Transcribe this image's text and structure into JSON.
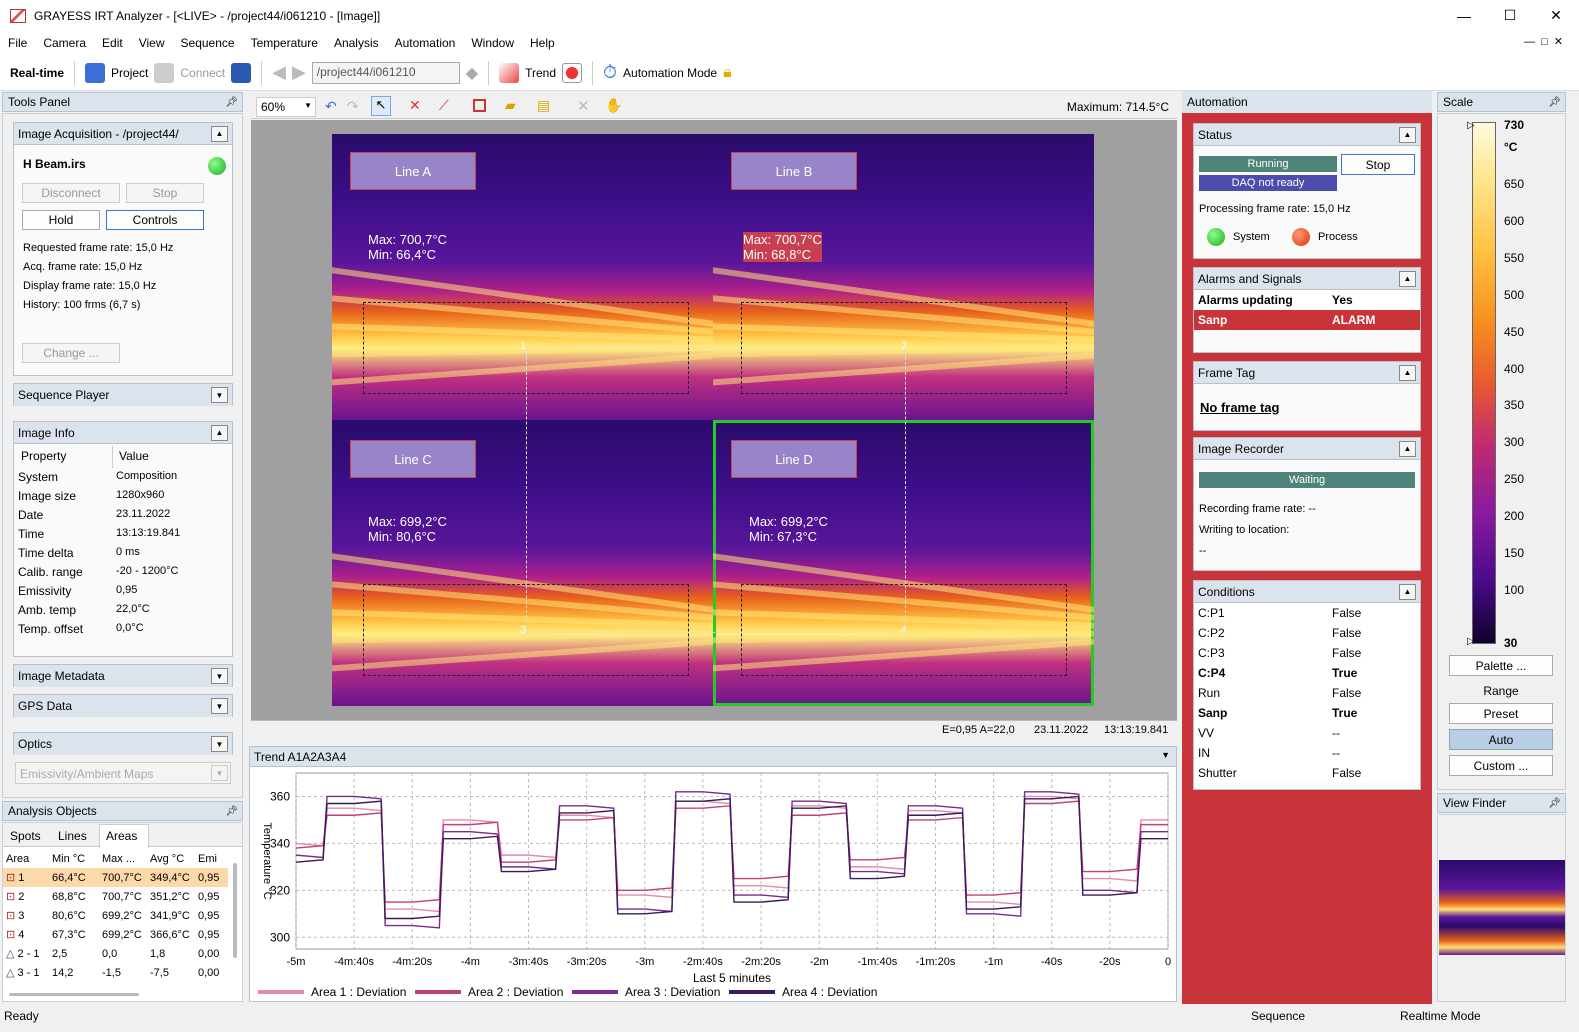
{
  "window": {
    "title": "GRAYESS IRT Analyzer - [<LIVE> - /project44/i061210 - [Image]]",
    "minimize": "—",
    "maximize": "☐",
    "close": "✕"
  },
  "menu": [
    "File",
    "Camera",
    "Edit",
    "View",
    "Sequence",
    "Temperature",
    "Analysis",
    "Automation",
    "Window",
    "Help"
  ],
  "toolbar": {
    "realtime": "Real-time",
    "project": "Project",
    "connect": "Connect",
    "path": "/project44/i061210",
    "trend": "Trend",
    "automation_mode": "Automation Mode"
  },
  "tools_panel": {
    "title": "Tools Panel",
    "acq": {
      "header": "Image Acquisition - /project44/",
      "file": "H Beam.irs",
      "disconnect": "Disconnect",
      "stop": "Stop",
      "hold": "Hold",
      "controls": "Controls",
      "lines": [
        "Requested frame rate: 15,0 Hz",
        "Acq. frame rate: 15,0 Hz",
        "Display frame rate: 15,0 Hz",
        "History: 100 frms (6,7 s)"
      ],
      "change": "Change ..."
    },
    "sequence_player": "Sequence Player",
    "image_info": {
      "header": "Image Info",
      "col_property": "Property",
      "col_value": "Value",
      "rows": [
        {
          "k": "System",
          "v": "Composition"
        },
        {
          "k": "Image size",
          "v": "1280x960"
        },
        {
          "k": "Date",
          "v": "23.11.2022"
        },
        {
          "k": "Time",
          "v": "13:13:19.841"
        },
        {
          "k": "Time delta",
          "v": "0 ms"
        },
        {
          "k": "Calib. range",
          "v": "-20 - 1200°C"
        },
        {
          "k": "Emissivity",
          "v": "0,95"
        },
        {
          "k": "Amb. temp",
          "v": "22,0°C"
        },
        {
          "k": "Temp. offset",
          "v": "0,0°C"
        }
      ]
    },
    "image_metadata": "Image Metadata",
    "gps": "GPS Data",
    "optics": "Optics",
    "emissivity_maps": "Emissivity/Ambient Maps"
  },
  "analysis": {
    "title": "Analysis Objects",
    "tabs": [
      "Spots",
      "Lines",
      "Areas"
    ],
    "columns": [
      "Area",
      "Min °C",
      "Max ...",
      "Avg °C",
      "Emi"
    ],
    "rows": [
      [
        "1",
        "66,4°C",
        "700,7°C",
        "349,4°C",
        "0,95"
      ],
      [
        "2",
        "68,8°C",
        "700,7°C",
        "351,2°C",
        "0,95"
      ],
      [
        "3",
        "80,6°C",
        "699,2°C",
        "341,9°C",
        "0,95"
      ],
      [
        "4",
        "67,3°C",
        "699,2°C",
        "366,6°C",
        "0,95"
      ],
      [
        "2 - 1",
        "2,5",
        "0,0",
        "1,8",
        "0,00"
      ],
      [
        "3 - 1",
        "14,2",
        "-1,5",
        "-7,5",
        "0,00"
      ]
    ]
  },
  "image_view": {
    "zoom": "60%",
    "maximum": "Maximum: 714.5°C",
    "quadrants": [
      {
        "label": "Line A",
        "max": "Max: 700,7°C",
        "min": "Min: 66,4°C",
        "num": "1"
      },
      {
        "label": "Line B",
        "max": "Max: 700,7°C",
        "min": "Min: 68,8°C",
        "num": "2"
      },
      {
        "label": "Line C",
        "max": "Max: 699,2°C",
        "min": "Min: 80,6°C",
        "num": "3"
      },
      {
        "label": "Line D",
        "max": "Max: 699,2°C",
        "min": "Min: 67,3°C",
        "num": "4"
      }
    ],
    "status_ea": "E=0,95 A=22,0",
    "status_date": "23.11.2022",
    "status_time": "13:13:19.841"
  },
  "trend": {
    "title": "Trend A1A2A3A4",
    "ylabel": "Temperature °C",
    "xlabel": "Last 5 minutes",
    "legend": [
      {
        "name": "Area 1 : Deviation",
        "color": "#e58aa8"
      },
      {
        "name": "Area 2 : Deviation",
        "color": "#c0407a"
      },
      {
        "name": "Area 3 : Deviation",
        "color": "#7a2a90"
      },
      {
        "name": "Area 4 : Deviation",
        "color": "#3a1a5a"
      }
    ]
  },
  "chart_data": {
    "type": "line",
    "title": "Trend A1A2A3A4",
    "xlabel": "Last 5 minutes",
    "ylabel": "Temperature °C",
    "x_ticks": [
      "-5m",
      "-4m:40s",
      "-4m:20s",
      "-4m",
      "-3m:40s",
      "-3m:20s",
      "-3m",
      "-2m:40s",
      "-2m:20s",
      "-2m",
      "-1m:40s",
      "-1m:20s",
      "-1m",
      "-40s",
      "-20s",
      "0"
    ],
    "y_ticks": [
      300,
      320,
      340,
      360
    ],
    "ylim": [
      295,
      370
    ],
    "x": [
      -300,
      -280,
      -260,
      -240,
      -220,
      -200,
      -180,
      -160,
      -140,
      -120,
      -100,
      -80,
      -60,
      -40,
      -20,
      0
    ],
    "series": [
      {
        "name": "Area 1 : Deviation",
        "values": [
          340,
          355,
          312,
          350,
          335,
          352,
          318,
          358,
          322,
          356,
          330,
          354,
          315,
          360,
          325,
          350
        ]
      },
      {
        "name": "Area 2 : Deviation",
        "values": [
          338,
          352,
          315,
          348,
          332,
          350,
          320,
          355,
          325,
          352,
          333,
          350,
          318,
          357,
          328,
          348
        ]
      },
      {
        "name": "Area 3 : Deviation",
        "values": [
          335,
          360,
          305,
          345,
          330,
          356,
          312,
          362,
          318,
          358,
          328,
          356,
          310,
          362,
          320,
          345
        ]
      },
      {
        "name": "Area 4 : Deviation",
        "values": [
          332,
          357,
          308,
          342,
          328,
          353,
          310,
          358,
          315,
          355,
          325,
          352,
          312,
          359,
          318,
          342
        ]
      }
    ],
    "grid": true,
    "legend": "bottom"
  },
  "automation": {
    "title": "Automation",
    "status": {
      "header": "Status",
      "running": "Running",
      "stop": "Stop",
      "daq": "DAQ not ready",
      "rate": "Processing frame rate: 15,0 Hz",
      "system": "System",
      "process": "Process"
    },
    "alarms": {
      "header": "Alarms and Signals",
      "rows": [
        {
          "k": "Alarms updating",
          "v": "Yes"
        },
        {
          "k": "Sanp",
          "v": "ALARM"
        }
      ]
    },
    "frame_tag": {
      "header": "Frame Tag",
      "value": "No frame tag"
    },
    "recorder": {
      "header": "Image Recorder",
      "state": "Waiting",
      "rate": "Recording frame rate: --",
      "writing": "Writing to location:",
      "loc": "--"
    },
    "conditions": {
      "header": "Conditions",
      "rows": [
        {
          "k": "C:P1",
          "v": "False",
          "b": false
        },
        {
          "k": "C:P2",
          "v": "False",
          "b": false
        },
        {
          "k": "C:P3",
          "v": "False",
          "b": false
        },
        {
          "k": "C:P4",
          "v": "True",
          "b": true
        },
        {
          "k": "Run",
          "v": "False",
          "b": false
        },
        {
          "k": "Sanp",
          "v": "True",
          "b": true
        },
        {
          "k": "VV",
          "v": "--",
          "b": false
        },
        {
          "k": "IN",
          "v": "--",
          "b": false
        },
        {
          "k": "Shutter",
          "v": "False",
          "b": false
        }
      ]
    }
  },
  "scale": {
    "title": "Scale",
    "unit": "°C",
    "max": "730",
    "min": "30",
    "ticks": [
      "650",
      "600",
      "550",
      "500",
      "450",
      "400",
      "350",
      "300",
      "250",
      "200",
      "150",
      "100"
    ],
    "palette": "Palette ...",
    "range": "Range",
    "preset": "Preset",
    "auto": "Auto",
    "custom": "Custom ..."
  },
  "view_finder": "View Finder",
  "statusbar": {
    "left": "Ready",
    "seq": "Sequence",
    "mode": "Realtime Mode"
  }
}
